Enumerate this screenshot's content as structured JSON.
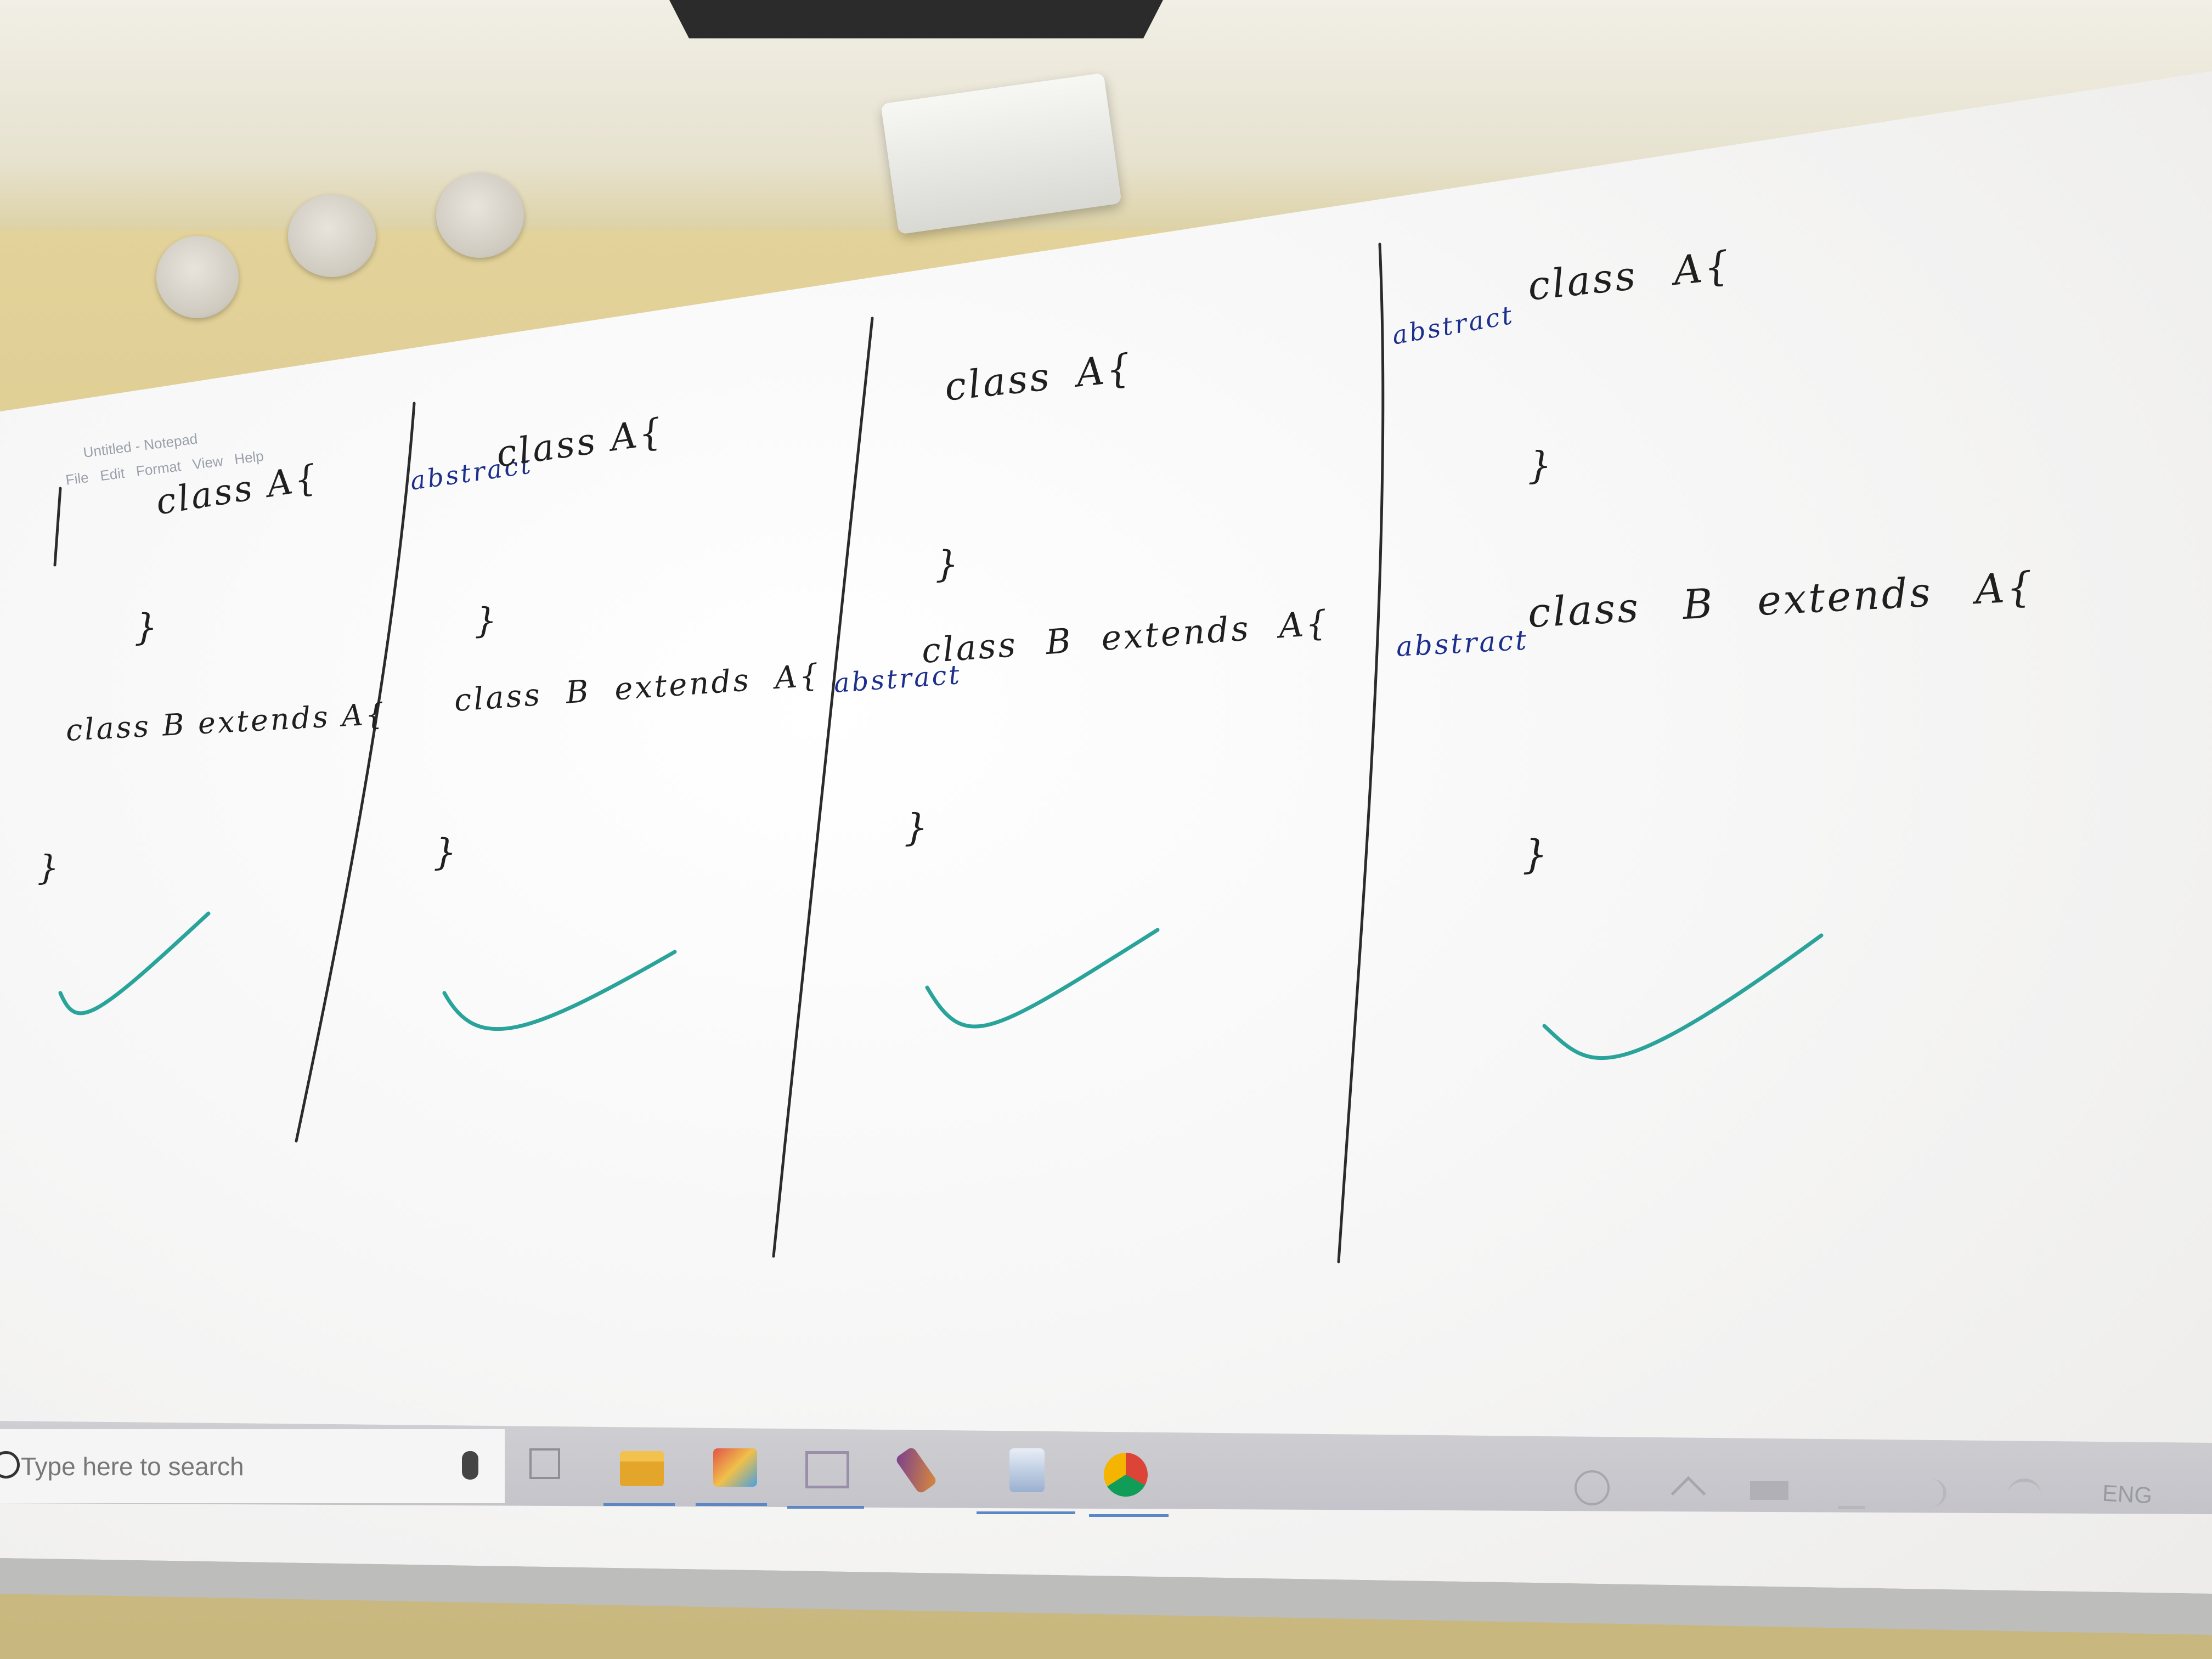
{
  "notepad": {
    "title": "Untitled - Notepad",
    "menu": "File Edit Format View Help"
  },
  "board": {
    "col1": {
      "line1": "class A{",
      "close1": "}",
      "line2": "class B extends A{",
      "close2": "}"
    },
    "col2": {
      "keyword": "abstract",
      "line1": "class A{",
      "close1": "}",
      "line2": "class B extends A{",
      "close2": "}"
    },
    "col3": {
      "line1": "class A{",
      "close1": "}",
      "keyword": "abstract",
      "line2": "class B extends A{",
      "close2": "}"
    },
    "col4": {
      "keyword1": "abstract",
      "line1": "class A{",
      "close1": "}",
      "keyword2": "abstract",
      "line2": "class B extends A{",
      "close2": "}"
    }
  },
  "taskbar": {
    "search_placeholder": "Type here to search",
    "tray_language": "ENG"
  },
  "colors": {
    "marker_black": "#1f1f1f",
    "marker_blue": "#1c2f8c",
    "checkmark_teal": "#2aa39a",
    "wall": "#e3d39a"
  },
  "icons": [
    "task-view-icon",
    "file-explorer-icon",
    "paint-icon",
    "window-icon",
    "brush-icon",
    "pointer-app-icon",
    "chrome-icon",
    "people-icon",
    "chevron-up-icon",
    "battery-icon",
    "volume-icon",
    "network-icon"
  ]
}
